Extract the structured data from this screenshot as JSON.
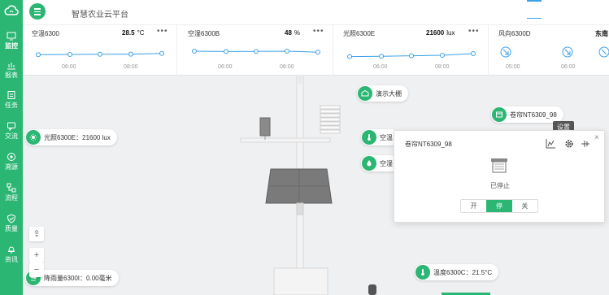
{
  "app": {
    "title": "智慧农业云平台"
  },
  "colors": {
    "brand": "#2bb673",
    "accent": "#3aa0e8"
  },
  "sidebar": {
    "items": [
      {
        "label": "监控",
        "icon": "monitor-icon",
        "active": true
      },
      {
        "label": "报表",
        "icon": "report-icon"
      },
      {
        "label": "任务",
        "icon": "task-icon"
      },
      {
        "label": "交流",
        "icon": "chat-icon"
      },
      {
        "label": "溯源",
        "icon": "trace-icon"
      },
      {
        "label": "流程",
        "icon": "flow-icon"
      },
      {
        "label": "质量",
        "icon": "quality-icon"
      },
      {
        "label": "资讯",
        "icon": "news-icon"
      }
    ]
  },
  "cards": [
    {
      "name": "空温6300",
      "value": "28.5",
      "unit": "°C",
      "ticks": [
        "06:00",
        "08:00"
      ],
      "trend": [
        69.2,
        69.0,
        68.8,
        68.6,
        67.8
      ]
    },
    {
      "name": "空湿6300B",
      "value": "48",
      "unit": "%",
      "ticks": [
        "06:00",
        "08:00"
      ],
      "trend": [
        65.0,
        65.4,
        65.2,
        65.0,
        66.2
      ]
    },
    {
      "name": "光照6300E",
      "value": "21600",
      "unit": "lux",
      "ticks": [
        "06:00",
        "08:00"
      ],
      "trend": [
        71.6,
        71.2,
        70.6,
        70.0,
        68.0
      ]
    },
    {
      "name": "风向6300D",
      "value": "东南",
      "unit": "",
      "ticks": [
        "05:00",
        "06:00"
      ],
      "arrows": 3
    }
  ],
  "tags": {
    "greenhouse": "演示大棚",
    "shutter": "卷帘NT6309_98",
    "light": "光照6300E：21600 lux",
    "temp_short": "空温",
    "humid_short": "空湿",
    "rain": "降雨量6300I：0.00毫米",
    "temp_c": "温度6300C：21.5°C"
  },
  "popup": {
    "title": "卷帘NT6309_98",
    "status": "已停止",
    "tooltip": "设置",
    "buttons": [
      "开",
      "停",
      "关"
    ],
    "active_button": 1
  },
  "controls": {
    "zoom_in": "+",
    "zoom_out": "−"
  }
}
